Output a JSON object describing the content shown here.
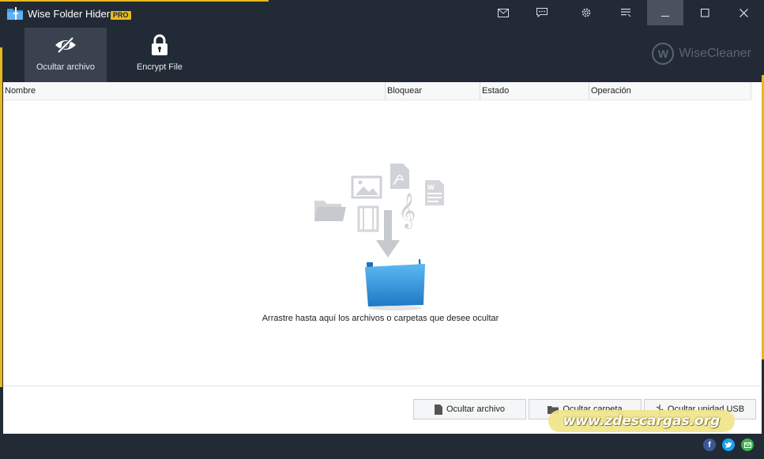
{
  "window": {
    "title": "Wise Folder Hider",
    "badge": "PRO"
  },
  "titlebar_buttons": [
    "mail-icon",
    "feedback-icon",
    "settings-icon",
    "menu-icon",
    "minimize-icon",
    "maximize-icon",
    "close-icon"
  ],
  "toolbar": {
    "items": [
      {
        "label": "Ocultar archivo",
        "icon": "eye-slash-icon",
        "selected": true
      },
      {
        "label": "Encrypt File",
        "icon": "lock-icon",
        "selected": false
      }
    ],
    "brand": {
      "logo_letter": "W",
      "text": "WiseCleaner"
    }
  },
  "table": {
    "columns": [
      "Nombre",
      "Bloquear",
      "Estado",
      "Operación"
    ]
  },
  "empty_state": {
    "message": "Arrastre hasta aquí los archivos o carpetas que desee ocultar"
  },
  "actions": {
    "hide_file": "Ocultar archivo",
    "hide_folder": "Ocultar carpeta",
    "hide_usb": "Ocultar unidad USB"
  },
  "watermark": "www.zdescargas.org",
  "colors": {
    "frame": "#222a36",
    "accent": "#e8b81f",
    "selected_tool": "#3a4250",
    "folder_blue": "#2f8fd6"
  }
}
